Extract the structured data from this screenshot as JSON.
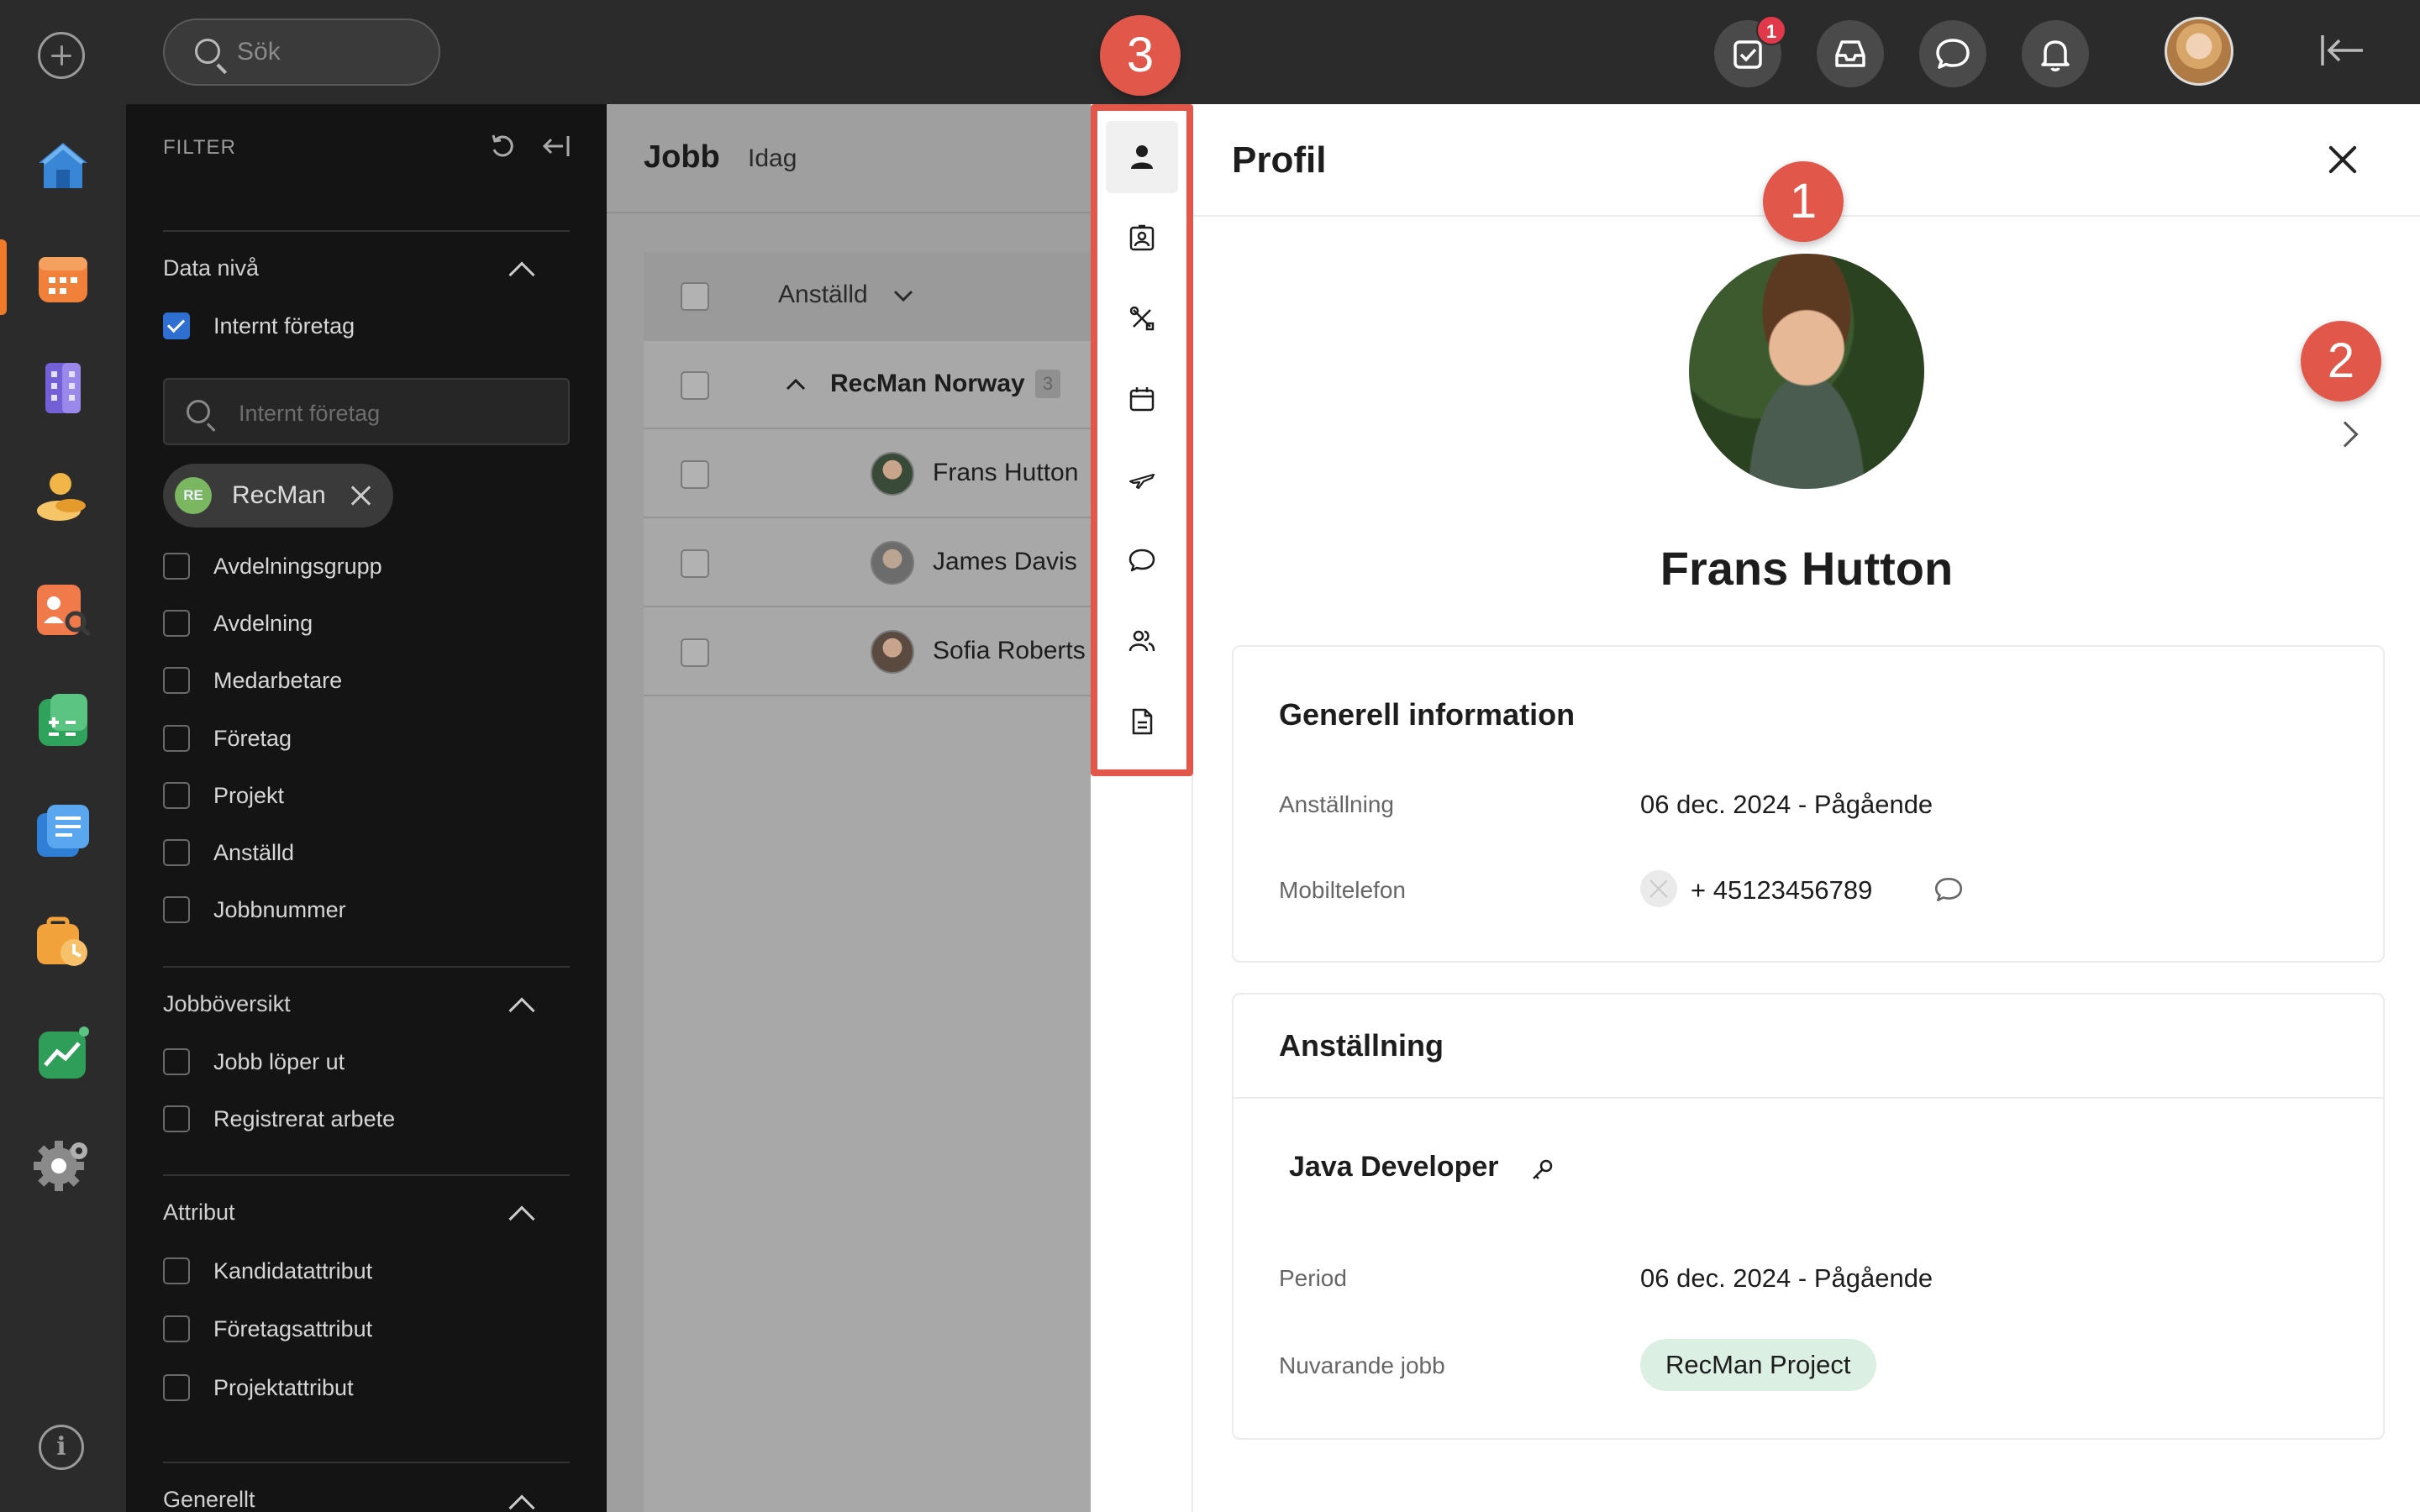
{
  "topbar": {
    "search_placeholder": "Sök",
    "tasks_badge": "1",
    "icons": [
      "tasks-icon",
      "inbox-icon",
      "chat-icon",
      "bell-icon",
      "user-avatar",
      "collapse-panel-icon"
    ]
  },
  "rail": {
    "apps": [
      "home",
      "calendar",
      "building",
      "people-coins",
      "candidate-search",
      "spreadsheet",
      "documents",
      "timesheet",
      "growth-chart",
      "settings"
    ],
    "active_index": 1
  },
  "filter": {
    "header": "FILTER",
    "sections": [
      {
        "title": "Data nivå",
        "items": [
          {
            "label": "Internt företag",
            "checked": true
          }
        ],
        "search_placeholder": "Internt företag",
        "chip": {
          "initials": "RE",
          "label": "RecMan"
        },
        "sub_items": [
          "Avdelningsgrupp",
          "Avdelning",
          "Medarbetare",
          "Företag",
          "Projekt",
          "Anställd",
          "Jobbnummer"
        ]
      },
      {
        "title": "Jobböversikt",
        "items": [
          "Jobb löper ut",
          "Registrerat arbete"
        ]
      },
      {
        "title": "Attribut",
        "items": [
          "Kandidatattribut",
          "Företagsattribut",
          "Projektattribut"
        ]
      },
      {
        "title": "Generellt",
        "items": []
      }
    ]
  },
  "main": {
    "title": "Jobb",
    "subtitle": "Idag",
    "column": "Anställd",
    "group": {
      "label": "RecMan Norway",
      "count": "3"
    },
    "rows": [
      "Frans Hutton",
      "James Davis",
      "Sofia Roberts"
    ]
  },
  "tabs": [
    "profile",
    "id-card",
    "tools",
    "calendar",
    "plane",
    "comment",
    "people",
    "document"
  ],
  "panel": {
    "title": "Profil",
    "name": "Frans Hutton",
    "general": {
      "title": "Generell information",
      "fields": [
        {
          "label": "Anställning",
          "value": "06 dec. 2024 - Pågående"
        },
        {
          "label": "Mobiltelefon",
          "value": "+ 45123456789"
        }
      ]
    },
    "employment": {
      "title": "Anställning",
      "job_title": "Java Developer",
      "period_label": "Period",
      "period_value": "06 dec. 2024 - Pågående",
      "current_label": "Nuvarande jobb",
      "current_value": "RecMan Project"
    }
  },
  "callouts": [
    "1",
    "2",
    "3"
  ],
  "colors": {
    "accent": "#e1574a",
    "checkbox": "#2f6fd1",
    "tag_bg": "#dcefe3",
    "active_bar": "#f07a2a"
  }
}
